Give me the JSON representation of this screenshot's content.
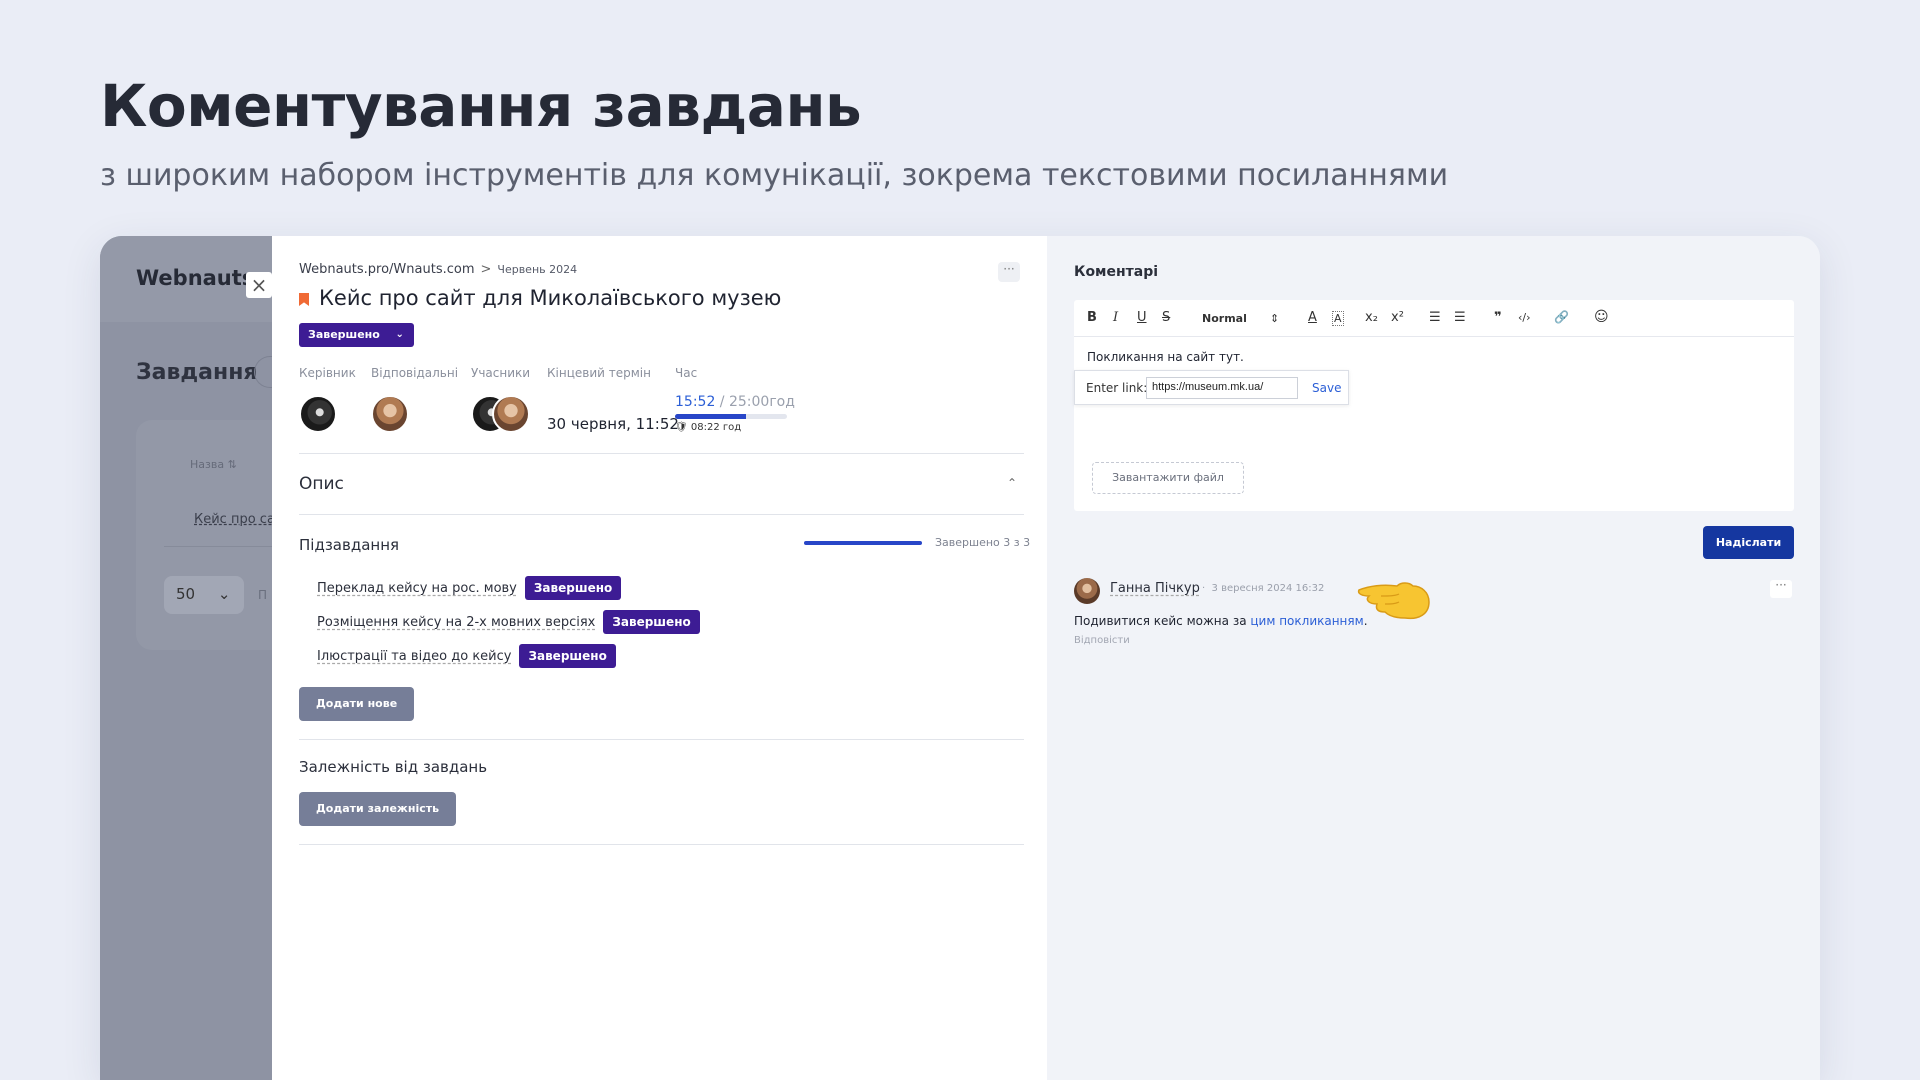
{
  "hero": {
    "title": "Коментування завдань",
    "subtitle": "з широким набором інструментів для комунікації, зокрема текстовими посиланнями"
  },
  "background_app": {
    "logo": "Webnauts",
    "close_icon": "×",
    "heading": "Завдання",
    "column_label": "Назва",
    "sort_icon": "⇅",
    "row_text": "Кейс про сайт для Миколаївського музею",
    "page_size": "50",
    "pager_right": "П"
  },
  "task": {
    "breadcrumb": {
      "project": "Webnauts.pro/Wnauts.com",
      "separator": ">",
      "date": "Червень 2024"
    },
    "more_icon": "···",
    "title": "Кейс про сайт для Миколаївського музею",
    "status": "Завершено",
    "status_chevron": "⌄",
    "labels": {
      "manager": "Керівник",
      "responsible": "Відповідальні",
      "participants": "Учасники",
      "deadline": "Кінцевий термін",
      "time": "Час"
    },
    "deadline": "30 червня, 11:52",
    "time": {
      "spent": "15:52",
      "estimate": " / 25:00год",
      "progress": 0.63,
      "sub_icon": "🛡",
      "sub": "08:22 год"
    },
    "description": {
      "title": "Опис",
      "toggle_icon": "⌃"
    },
    "subtasks": {
      "title": "Підзавдання",
      "progress": 1.0,
      "summary": "Завершено 3 з 3",
      "items": [
        {
          "name": "Переклад кейсу на рос. мову",
          "status": "Завершено"
        },
        {
          "name": "Розміщення кейсу на 2-х мовних версіях",
          "status": "Завершено"
        },
        {
          "name": "Ілюстрації та відео до кейсу",
          "status": "Завершено"
        }
      ],
      "add_button": "Додати нове"
    },
    "dependencies": {
      "title": "Залежність від завдань",
      "add_button": "Додати залежність"
    }
  },
  "comments": {
    "title": "Коментарі",
    "toolbar": {
      "bold": "B",
      "italic": "I",
      "underline": "U",
      "strike": "S",
      "size": "Normal",
      "size_arrows": "⇕",
      "text_color": "A",
      "bg_color": "A",
      "subscript": "x₂",
      "superscript": "x²",
      "ordered_list": "☰",
      "bullet_list": "☰",
      "quote": "❞",
      "code": "‹/›",
      "link": "🔗",
      "emoji": "☺"
    },
    "editor_text": "Покликання на сайт тут.",
    "link_popup": {
      "label": "Enter link:",
      "value": "https://museum.mk.ua/",
      "save": "Save"
    },
    "upload": "Завантажити файл",
    "send": "Надіслати",
    "comment": {
      "author": "Ганна Пічкур",
      "date": "3 вересня 2024 16:32",
      "dot": "·",
      "text_before": "Подивитися кейс можна за ",
      "link_text": "цим покликанням",
      "text_after": ".",
      "reply": "Відповісти",
      "more_icon": "···"
    }
  }
}
